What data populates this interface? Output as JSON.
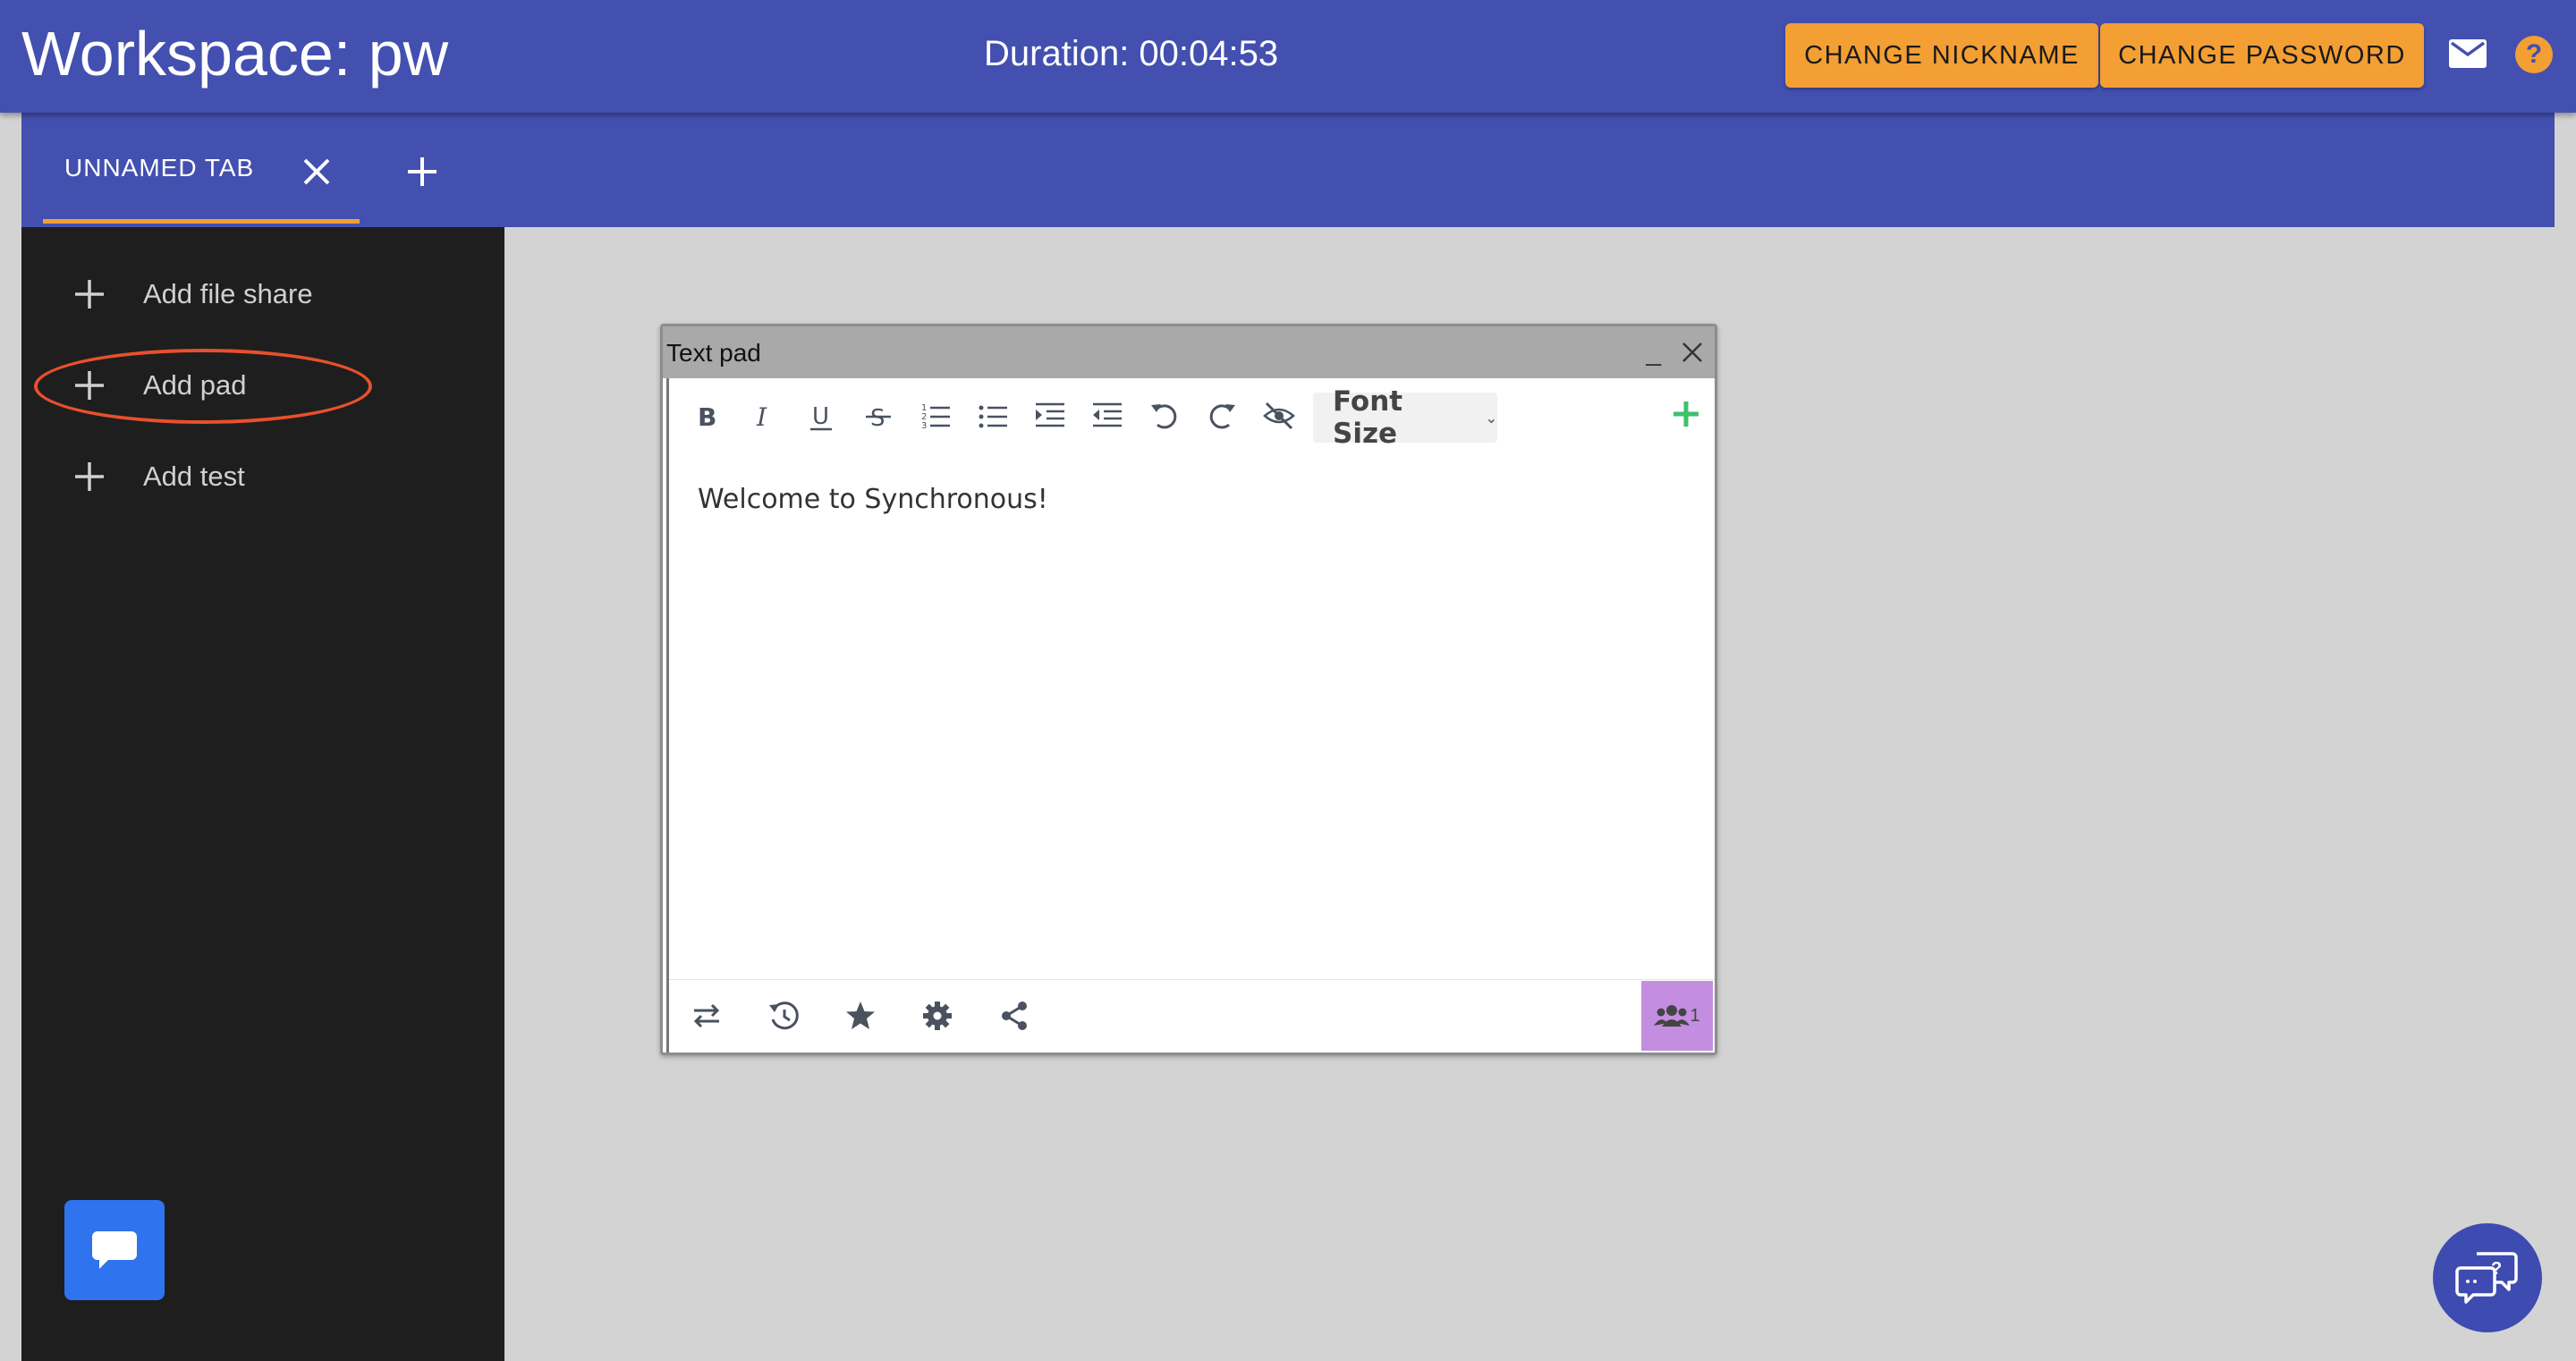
{
  "header": {
    "title": "Workspace: pw",
    "duration": "Duration: 00:04:53",
    "change_nickname_label": "CHANGE NICKNAME",
    "change_password_label": "CHANGE PASSWORD",
    "help_label": "?"
  },
  "tabs": [
    {
      "label": "UNNAMED TAB",
      "active": true
    }
  ],
  "sidebar": {
    "items": [
      {
        "label": "Add file share",
        "icon": "plus-icon"
      },
      {
        "label": "Add pad",
        "icon": "plus-icon",
        "highlighted": true
      },
      {
        "label": "Add test",
        "icon": "plus-icon"
      }
    ]
  },
  "pad": {
    "title": "Text pad",
    "minimize_label": "_",
    "toolbar": {
      "icons": [
        "bold-icon",
        "italic-icon",
        "underline-icon",
        "strikethrough-icon",
        "ordered-list-icon",
        "unordered-list-icon",
        "indent-icon",
        "outdent-icon",
        "undo-icon",
        "redo-icon",
        "hide-icon"
      ],
      "font_size_label": "Font Size",
      "caret": "⌄"
    },
    "content": "Welcome to Synchronous!",
    "bottom_icons": [
      "import-export-icon",
      "timeslider-icon",
      "star-icon",
      "settings-icon",
      "share-icon"
    ],
    "user_count": "1"
  },
  "colors": {
    "primary": "#4350b0",
    "accent": "#f39f34",
    "sidebar": "#1e1e1e",
    "canvas": "#d3d3d3",
    "highlight": "#e8502c",
    "chat_button": "#2f73ee",
    "users_badge": "#c38ee0"
  }
}
